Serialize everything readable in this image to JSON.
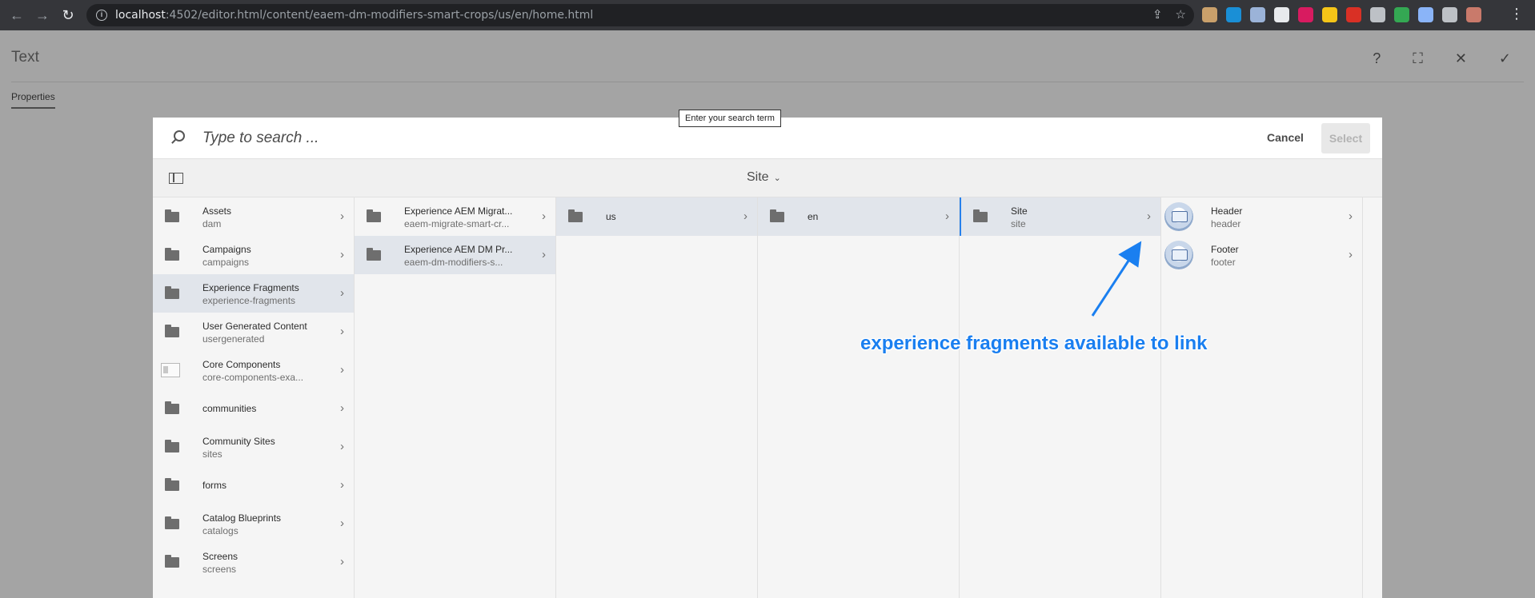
{
  "browser": {
    "url_host": "localhost",
    "url_rest": ":4502/editor.html/content/eaem-dm-modifiers-smart-crops/us/en/home.html",
    "ext_colors": [
      "#c9a06b",
      "#1a8fd6",
      "#9bb3d8",
      "#e8eaed",
      "#d81b60",
      "#f5c518",
      "#d93025",
      "#bdc1c6",
      "#34a853",
      "#8ab4f8",
      "#bdc1c6",
      "#c97a6b"
    ]
  },
  "editor": {
    "title": "Text",
    "tab": "Properties"
  },
  "tooltip": "Enter your search term",
  "search": {
    "placeholder": "Type to search ...",
    "cancel": "Cancel",
    "select": "Select"
  },
  "toolbar": {
    "site": "Site"
  },
  "columns": [
    {
      "items": [
        {
          "title": "Assets",
          "sub": "dam",
          "icon": "folder"
        },
        {
          "title": "Campaigns",
          "sub": "campaigns",
          "icon": "folder"
        },
        {
          "title": "Experience Fragments",
          "sub": "experience-fragments",
          "icon": "folder",
          "selected": true
        },
        {
          "title": "User Generated Content",
          "sub": "usergenerated",
          "icon": "folder"
        },
        {
          "title": "Core Components",
          "sub": "core-components-exa...",
          "icon": "component"
        },
        {
          "title": "communities",
          "sub": "",
          "icon": "folder"
        },
        {
          "title": "Community Sites",
          "sub": "sites",
          "icon": "folder"
        },
        {
          "title": "forms",
          "sub": "",
          "icon": "folder"
        },
        {
          "title": "Catalog Blueprints",
          "sub": "catalogs",
          "icon": "folder"
        },
        {
          "title": "Screens",
          "sub": "screens",
          "icon": "folder"
        }
      ]
    },
    {
      "items": [
        {
          "title": "Experience AEM Migrat...",
          "sub": "eaem-migrate-smart-cr...",
          "icon": "folder"
        },
        {
          "title": "Experience AEM DM Pr...",
          "sub": "eaem-dm-modifiers-s...",
          "icon": "folder",
          "selected": true
        }
      ]
    },
    {
      "items": [
        {
          "title": "us",
          "sub": "",
          "icon": "folder",
          "selected": true
        }
      ]
    },
    {
      "items": [
        {
          "title": "en",
          "sub": "",
          "icon": "folder",
          "selected": true
        }
      ]
    },
    {
      "items": [
        {
          "title": "Site",
          "sub": "site",
          "icon": "folder",
          "current": true
        }
      ]
    },
    {
      "items": [
        {
          "title": "Header",
          "sub": "header",
          "icon": "thumbnail"
        },
        {
          "title": "Footer",
          "sub": "footer",
          "icon": "thumbnail"
        }
      ]
    }
  ],
  "annotation": "experience fragments available to link",
  "colors": {
    "accent": "#2680eb",
    "annotation": "#1a7ff0",
    "selected_row": "#e1e5eb"
  }
}
